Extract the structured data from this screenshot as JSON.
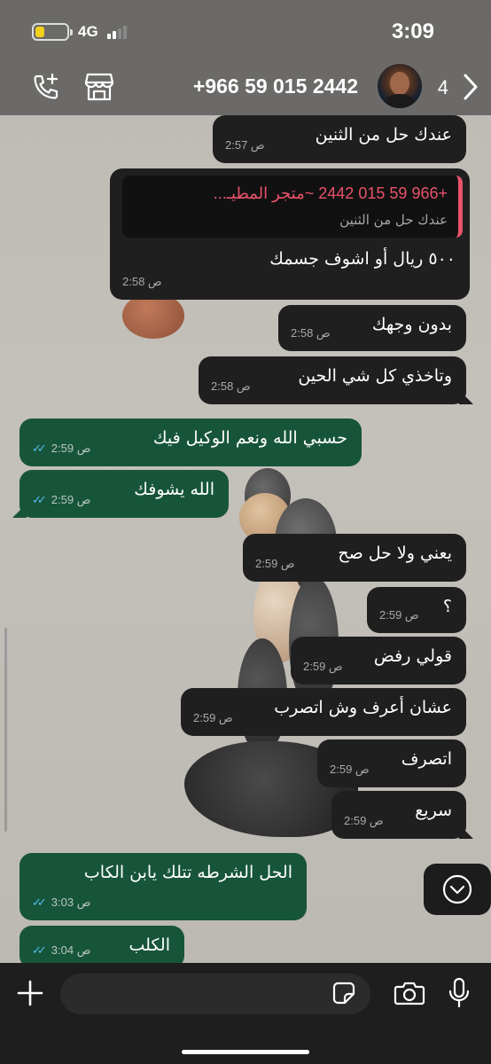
{
  "status_bar": {
    "time": "3:09",
    "network": "4G",
    "battery_level": 0.3
  },
  "header": {
    "contact": "+966 59 015 2442",
    "unread_count": "4"
  },
  "colors": {
    "incoming_bubble": "#1f1f1f",
    "outgoing_bubble": "#17553b",
    "quote_accent": "#e9536a",
    "read_ticks": "#53bdeb"
  },
  "messages": [
    {
      "dir": "in",
      "text": "عندك حل من الثنين",
      "time": "2:57 ص"
    },
    {
      "dir": "in",
      "quote_sender": "+966 59 015 2442 ~متجر المطيـ...",
      "quote_text": "عندك حل من الثنين",
      "text": "٥٠٠ ريال أو اشوف جسمك",
      "time": "2:58 ص"
    },
    {
      "dir": "in",
      "text": "بدون وجهك",
      "time": "2:58 ص"
    },
    {
      "dir": "in",
      "text": "وتاخذي كل شي الحين",
      "time": "2:58 ص"
    },
    {
      "dir": "out",
      "text": "حسبي الله ونعم الوكيل فيك",
      "time": "2:59 ص"
    },
    {
      "dir": "out",
      "text": "الله يشوفك",
      "time": "2:59 ص"
    },
    {
      "dir": "in",
      "text": "يعني ولا حل صح",
      "time": "2:59 ص"
    },
    {
      "dir": "in",
      "text": "؟",
      "time": "2:59 ص"
    },
    {
      "dir": "in",
      "text": "قولي رفض",
      "time": "2:59 ص"
    },
    {
      "dir": "in",
      "text": "عشان أعرف وش اتصرب",
      "time": "2:59 ص"
    },
    {
      "dir": "in",
      "text": "اتصرف",
      "time": "2:59 ص"
    },
    {
      "dir": "in",
      "text": "سريع",
      "time": "2:59 ص"
    },
    {
      "dir": "out",
      "text": "الحل الشرطه تتلك يابن الكاب",
      "time": "3:03 ص"
    },
    {
      "dir": "out",
      "text": "الكلب",
      "time": "3:04 ص"
    }
  ],
  "composer": {
    "value": "",
    "placeholder": ""
  },
  "icons": {
    "call": "add-call-icon",
    "store": "store-icon",
    "back": "chevron-right-icon",
    "scroll": "chevron-down-icon",
    "attach": "plus-icon",
    "sticker": "sticker-icon",
    "camera": "camera-icon",
    "mic": "microphone-icon"
  }
}
